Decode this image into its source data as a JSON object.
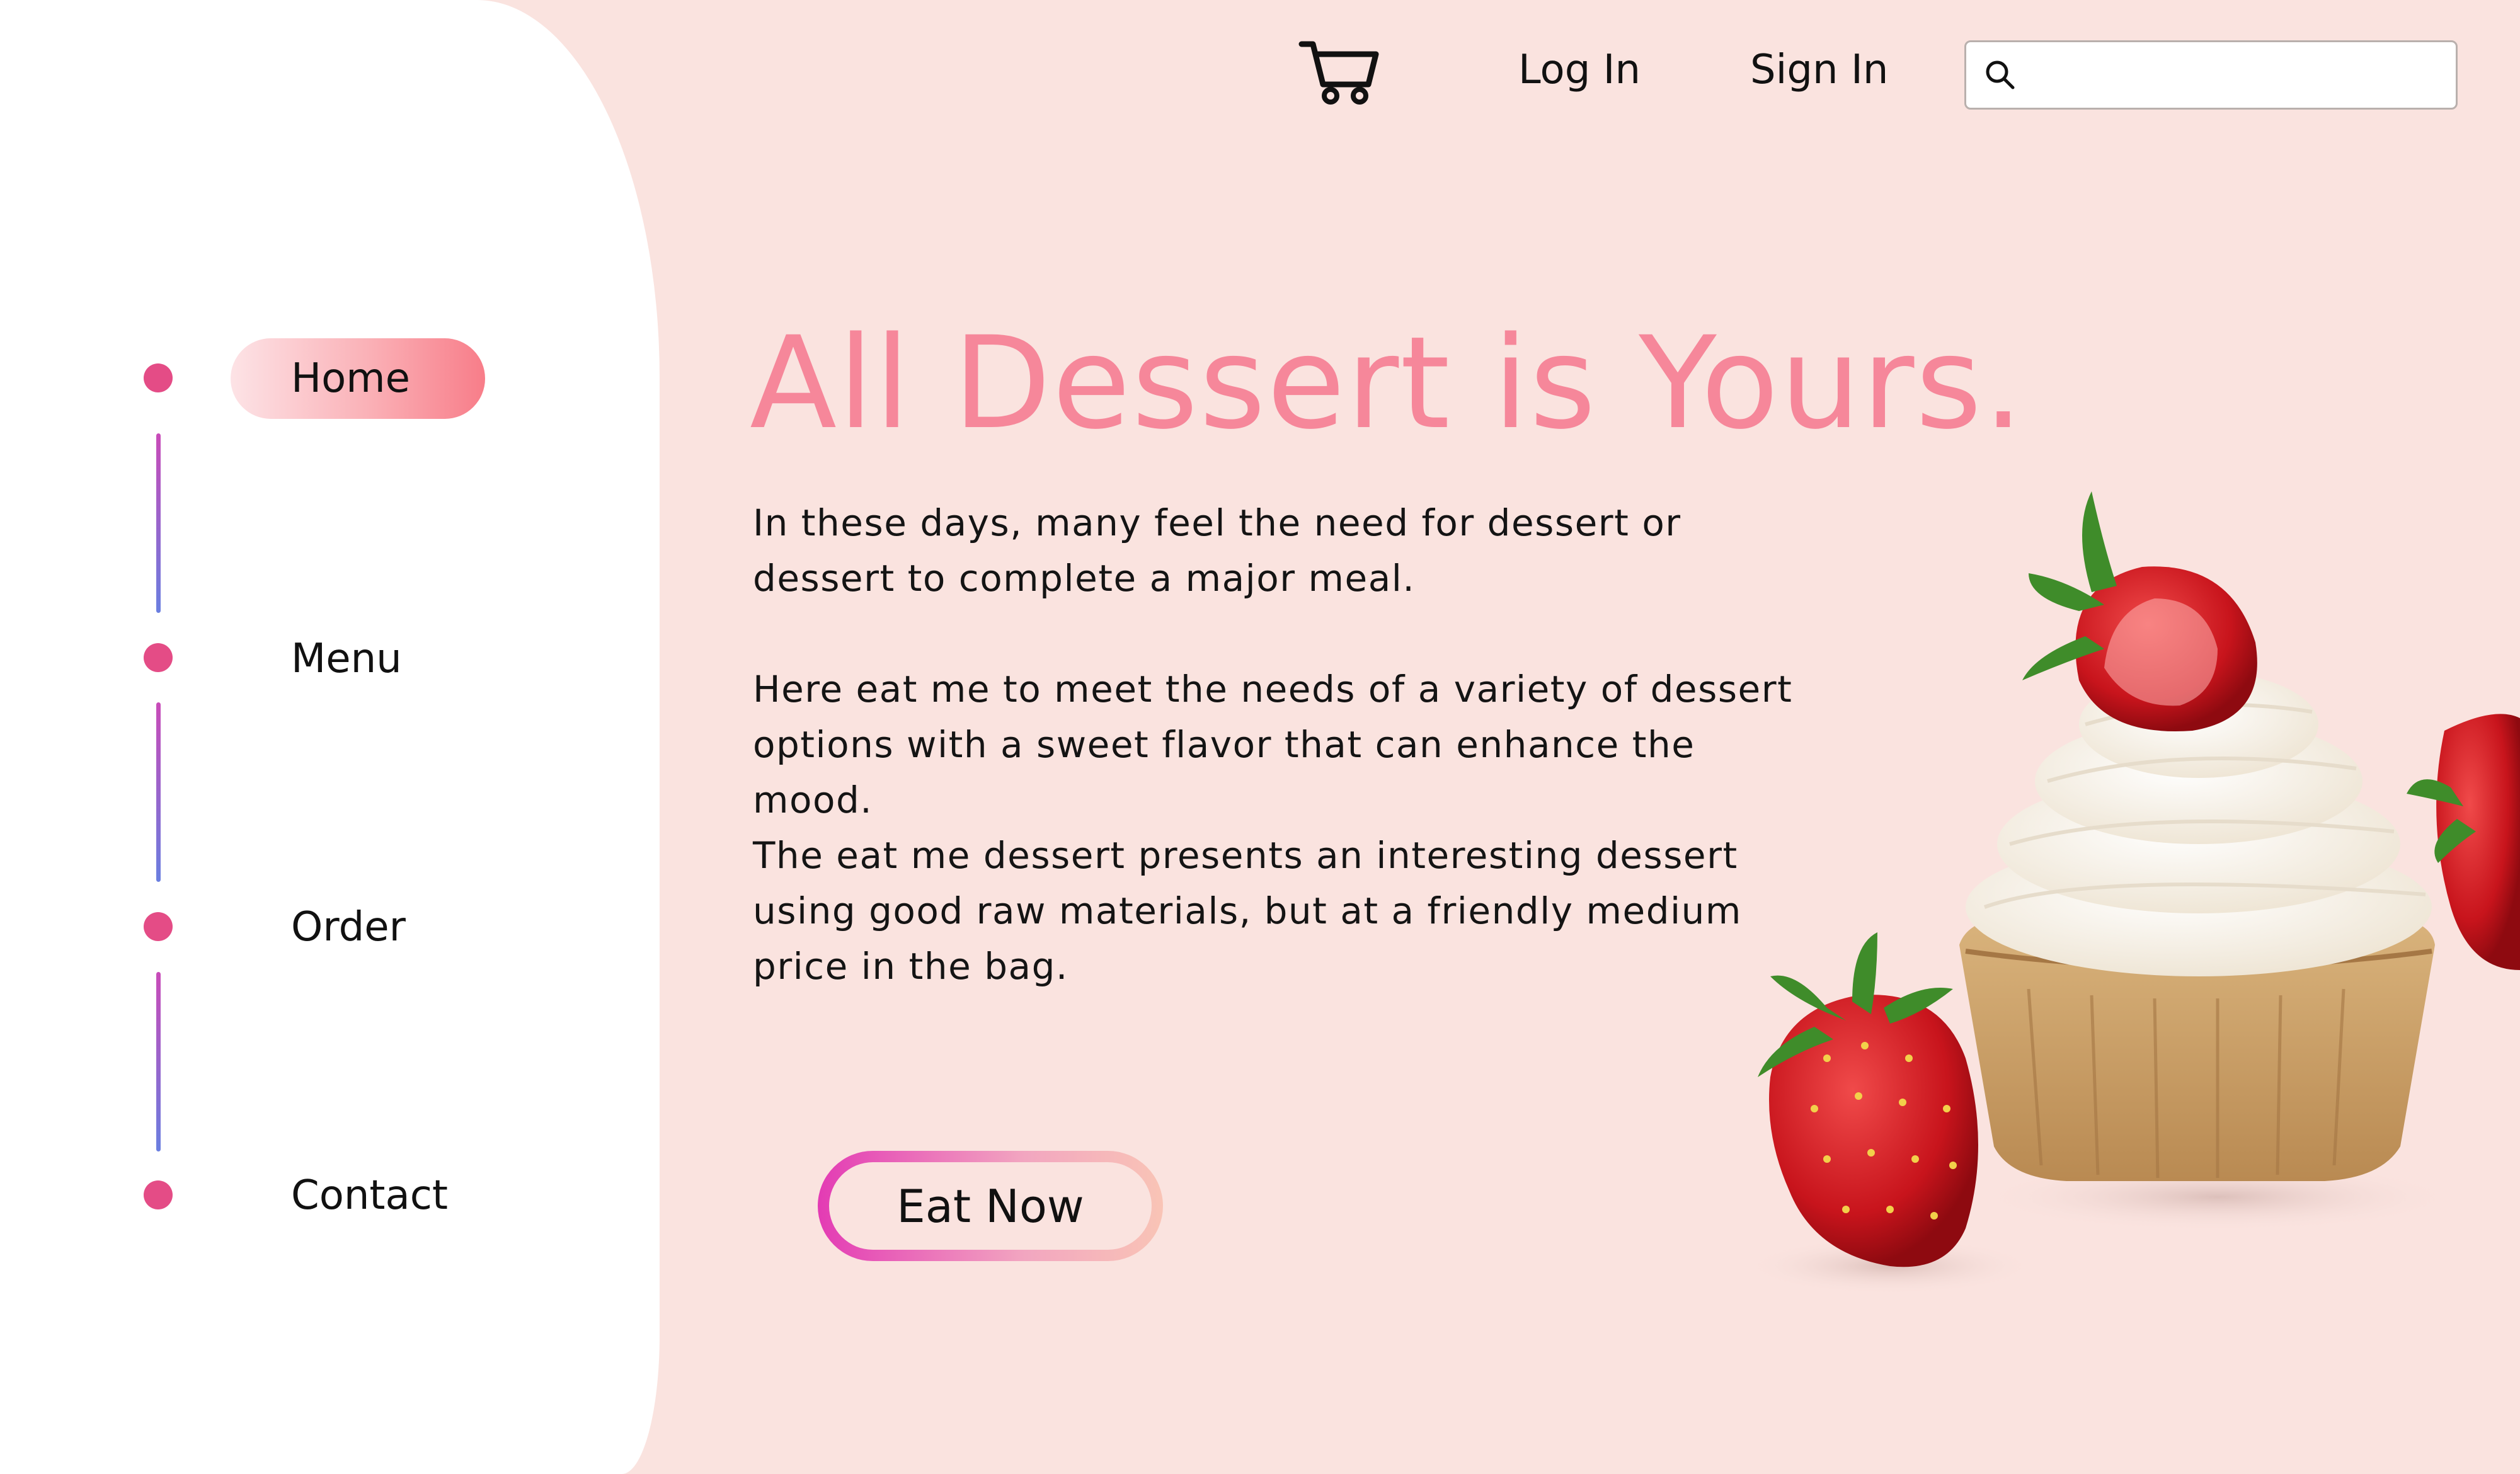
{
  "header": {
    "cart_icon": "shopping-cart-icon",
    "login_label": "Log In",
    "signin_label": "Sign In",
    "search": {
      "value": "",
      "placeholder": "",
      "icon": "search-icon"
    }
  },
  "sidebar": {
    "items": [
      {
        "label": "Home",
        "active": true
      },
      {
        "label": "Menu",
        "active": false
      },
      {
        "label": "Order",
        "active": false
      },
      {
        "label": "Contact",
        "active": false
      }
    ]
  },
  "hero": {
    "title": "All Dessert is Yours.",
    "paragraphs": [
      "In these days, many feel the need for dessert or dessert to complete a major meal.",
      "Here eat me to meet the needs of a variety of dessert options with a sweet flavor that can enhance the mood.",
      "The eat me dessert presents an interesting dessert using good raw materials, but at a friendly medium price in the bag."
    ],
    "cta_label": "Eat Now"
  },
  "colors": {
    "background": "#fae3df",
    "accent_pink": "#f6879a",
    "nav_dot": "#e44c86",
    "cta_gradient_start": "#e33bb4",
    "cta_gradient_end": "#f9c4b6"
  },
  "illustration": {
    "name": "cupcake-with-strawberries"
  }
}
